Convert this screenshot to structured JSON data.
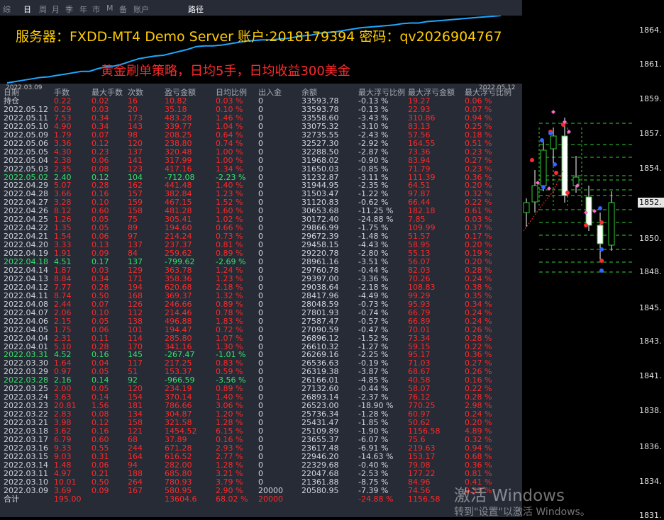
{
  "tabs": [
    "综",
    "日",
    "周",
    "月",
    "季",
    "年",
    "市",
    "M",
    "备",
    "账户",
    "路径"
  ],
  "banner": {
    "line1": "服务器：FXDD-MT4 Demo Server  账户:2018179394    密码：qv2026904767",
    "line2": "黄金刷单策略，日均5手，日均收益300美金",
    "date_start": "2022.03.09",
    "date_end": "2022.05.12",
    "equity_curve": [
      0,
      2,
      4,
      6,
      8,
      9,
      11,
      13,
      15,
      17,
      17,
      21,
      24,
      25,
      28,
      32,
      36,
      38,
      40,
      41,
      44,
      47,
      50,
      54,
      55,
      55,
      56,
      58,
      60,
      62,
      63,
      64,
      64,
      65,
      66,
      68,
      70,
      71,
      74,
      75,
      76,
      78,
      80,
      82,
      83,
      84,
      85,
      86,
      88,
      89,
      89,
      91,
      92,
      93,
      94,
      95,
      96,
      97,
      98,
      99,
      100
    ]
  },
  "table": {
    "headers": [
      "日期",
      "手数",
      "最大手数",
      "次数",
      "盈亏金额",
      "日均比例",
      "出入金",
      "余额",
      "最大浮亏比例",
      "最大浮亏金额",
      "最大浮亏比例"
    ],
    "rows": [
      [
        "持仓",
        "0.22",
        "0.02",
        "16",
        "10.82",
        "0.03 %",
        "0",
        "33593.78",
        "-0.13 %",
        "19.27",
        "0.06 %"
      ],
      [
        "2022.05.12",
        "0.29",
        "0.03",
        "20",
        "35.18",
        "0.10 %",
        "0",
        "33593.78",
        "-0.13 %",
        "22.93",
        "0.07 %"
      ],
      [
        "2022.05.11",
        "7.53",
        "0.34",
        "173",
        "483.28",
        "1.46 %",
        "0",
        "33558.60",
        "-3.43 %",
        "310.86",
        "0.94 %"
      ],
      [
        "2022.05.10",
        "4.90",
        "0.34",
        "143",
        "339.77",
        "1.04 %",
        "0",
        "33075.32",
        "-3.10 %",
        "83.13",
        "0.25 %"
      ],
      [
        "2022.05.09",
        "1.79",
        "0.07",
        "98",
        "208.25",
        "0.64 %",
        "0",
        "32735.55",
        "-2.43 %",
        "57.56",
        "0.18 %"
      ],
      [
        "2022.05.06",
        "3.36",
        "0.12",
        "120",
        "238.80",
        "0.74 %",
        "0",
        "32527.30",
        "-2.92 %",
        "164.55",
        "0.51 %"
      ],
      [
        "2022.05.05",
        "4.30",
        "0.23",
        "137",
        "320.48",
        "1.00 %",
        "0",
        "32288.50",
        "-2.87 %",
        "73.36",
        "0.23 %"
      ],
      [
        "2022.05.04",
        "2.38",
        "0.06",
        "141",
        "317.99",
        "1.00 %",
        "0",
        "31968.02",
        "-0.90 %",
        "83.94",
        "0.27 %"
      ],
      [
        "2022.05.03",
        "2.35",
        "0.08",
        "123",
        "417.16",
        "1.34 %",
        "0",
        "31650.03",
        "-0.85 %",
        "71.79",
        "0.23 %"
      ],
      [
        "2022.05.02",
        "2.40",
        "0.12",
        "104",
        "-712.08",
        "-2.23 %",
        "0",
        "31232.87",
        "-3.11 %",
        "111.39",
        "0.36 %"
      ],
      [
        "2022.04.29",
        "5.07",
        "0.28",
        "162",
        "441.48",
        "1.40 %",
        "0",
        "31944.95",
        "-2.35 %",
        "64.51",
        "0.20 %"
      ],
      [
        "2022.04.28",
        "3.66",
        "0.16",
        "157",
        "382.84",
        "1.23 %",
        "0",
        "31503.47",
        "-1.22 %",
        "97.87",
        "0.32 %"
      ],
      [
        "2022.04.27",
        "3.28",
        "0.10",
        "159",
        "467.15",
        "1.52 %",
        "0",
        "31120.83",
        "-0.62 %",
        "66.44",
        "0.22 %"
      ],
      [
        "2022.04.26",
        "8.12",
        "0.60",
        "158",
        "481.28",
        "1.60 %",
        "0",
        "30653.68",
        "-11.25 %",
        "182.18",
        "0.61 %"
      ],
      [
        "2022.04.25",
        "1.26",
        "0.05",
        "75",
        "305.41",
        "1.02 %",
        "0",
        "30172.40",
        "-24.88 %",
        "7.85",
        "0.03 %"
      ],
      [
        "2022.04.22",
        "1.35",
        "0.05",
        "89",
        "194.60",
        "0.66 %",
        "0",
        "29866.99",
        "-1.75 %",
        "109.99",
        "0.37 %"
      ],
      [
        "2022.04.21",
        "1.54",
        "0.06",
        "97",
        "214.24",
        "0.73 %",
        "0",
        "29672.39",
        "-1.48 %",
        "51.57",
        "0.17 %"
      ],
      [
        "2022.04.20",
        "3.33",
        "0.13",
        "137",
        "237.37",
        "0.81 %",
        "0",
        "29458.15",
        "-4.43 %",
        "58.95",
        "0.20 %"
      ],
      [
        "2022.04.19",
        "1.91",
        "0.09",
        "84",
        "259.62",
        "0.89 %",
        "0",
        "29220.78",
        "-2.80 %",
        "55.13",
        "0.19 %"
      ],
      [
        "2022.04.18",
        "4.51",
        "0.17",
        "137",
        "-799.62",
        "-2.69 %",
        "0",
        "28961.16",
        "-3.51 %",
        "56.07",
        "0.20 %"
      ],
      [
        "2022.04.14",
        "1.87",
        "0.03",
        "129",
        "363.78",
        "1.24 %",
        "0",
        "29760.78",
        "-0.44 %",
        "82.03",
        "0.28 %"
      ],
      [
        "2022.04.13",
        "8.84",
        "0.34",
        "171",
        "358.36",
        "1.23 %",
        "0",
        "29397.00",
        "-3.36 %",
        "70.26",
        "0.24 %"
      ],
      [
        "2022.04.12",
        "7.77",
        "0.28",
        "194",
        "620.68",
        "2.18 %",
        "0",
        "29038.64",
        "-2.18 %",
        "108.83",
        "0.38 %"
      ],
      [
        "2022.04.11",
        "8.74",
        "0.50",
        "168",
        "369.37",
        "1.32 %",
        "0",
        "28417.96",
        "-4.49 %",
        "99.29",
        "0.35 %"
      ],
      [
        "2022.04.08",
        "2.44",
        "0.07",
        "126",
        "246.66",
        "0.89 %",
        "0",
        "28048.59",
        "-0.73 %",
        "95.93",
        "0.34 %"
      ],
      [
        "2022.04.07",
        "2.06",
        "0.10",
        "112",
        "214.46",
        "0.78 %",
        "0",
        "27801.93",
        "-0.74 %",
        "66.79",
        "0.24 %"
      ],
      [
        "2022.04.06",
        "2.15",
        "0.05",
        "138",
        "496.88",
        "1.83 %",
        "0",
        "27587.47",
        "-0.57 %",
        "66.89",
        "0.24 %"
      ],
      [
        "2022.04.05",
        "1.75",
        "0.06",
        "101",
        "194.47",
        "0.72 %",
        "0",
        "27090.59",
        "-0.47 %",
        "70.01",
        "0.26 %"
      ],
      [
        "2022.04.04",
        "2.31",
        "0.11",
        "114",
        "285.80",
        "1.07 %",
        "0",
        "26896.12",
        "-1.52 %",
        "73.34",
        "0.28 %"
      ],
      [
        "2022.04.01",
        "5.10",
        "0.28",
        "170",
        "341.16",
        "1.30 %",
        "0",
        "26610.32",
        "-1.27 %",
        "59.15",
        "0.22 %"
      ],
      [
        "2022.03.31",
        "4.52",
        "0.16",
        "145",
        "-267.47",
        "-1.01 %",
        "0",
        "26269.16",
        "-2.25 %",
        "95.17",
        "0.36 %"
      ],
      [
        "2022.03.30",
        "1.64",
        "0.04",
        "117",
        "217.25",
        "0.83 %",
        "0",
        "26536.63",
        "-0.19 %",
        "71.03",
        "0.27 %"
      ],
      [
        "2022.03.29",
        "0.97",
        "0.05",
        "51",
        "153.37",
        "0.59 %",
        "0",
        "26319.38",
        "-3.87 %",
        "68.67",
        "0.26 %"
      ],
      [
        "2022.03.28",
        "2.16",
        "0.14",
        "92",
        "-966.59",
        "-3.56 %",
        "0",
        "26166.01",
        "-4.85 %",
        "40.58",
        "0.16 %"
      ],
      [
        "2022.03.25",
        "2.00",
        "0.05",
        "120",
        "234.19",
        "0.89 %",
        "0",
        "27132.60",
        "-0.44 %",
        "58.07",
        "0.22 %"
      ],
      [
        "2022.03.24",
        "3.63",
        "0.14",
        "154",
        "370.14",
        "1.40 %",
        "0",
        "26893.14",
        "-2.37 %",
        "76.12",
        "0.28 %"
      ],
      [
        "2022.03.23",
        "20.81",
        "1.56",
        "181",
        "786.66",
        "3.06 %",
        "0",
        "26523.00",
        "-18.90 %",
        "770.25",
        "2.98 %"
      ],
      [
        "2022.03.22",
        "2.83",
        "0.08",
        "134",
        "304.87",
        "1.20 %",
        "0",
        "25736.34",
        "-1.28 %",
        "60.97",
        "0.24 %"
      ],
      [
        "2022.03.21",
        "3.98",
        "0.12",
        "158",
        "321.58",
        "1.28 %",
        "0",
        "25431.47",
        "-1.85 %",
        "50.62",
        "0.20 %"
      ],
      [
        "2022.03.18",
        "3.62",
        "0.16",
        "121",
        "1454.52",
        "6.15 %",
        "0",
        "25109.89",
        "-1.90 %",
        "1156.58",
        "4.89 %"
      ],
      [
        "2022.03.17",
        "6.79",
        "0.60",
        "68",
        "37.89",
        "0.16 %",
        "0",
        "23655.37",
        "-6.07 %",
        "75.6",
        "0.32 %"
      ],
      [
        "2022.03.16",
        "9.33",
        "0.55",
        "244",
        "671.28",
        "2.93 %",
        "0",
        "23617.48",
        "-6.91 %",
        "219.63",
        "0.94 %"
      ],
      [
        "2022.03.15",
        "9.03",
        "0.31",
        "164",
        "616.52",
        "2.77 %",
        "0",
        "22946.20",
        "-14.63 %",
        "153.17",
        "0.68 %"
      ],
      [
        "2022.03.14",
        "1.48",
        "0.06",
        "94",
        "282.00",
        "1.28 %",
        "0",
        "22329.68",
        "-0.40 %",
        "79.08",
        "0.36 %"
      ],
      [
        "2022.03.11",
        "4.97",
        "0.21",
        "188",
        "685.80",
        "3.21 %",
        "0",
        "22047.68",
        "-2.53 %",
        "177.22",
        "0.81 %"
      ],
      [
        "2022.03.10",
        "10.01",
        "0.50",
        "264",
        "780.93",
        "3.79 %",
        "0",
        "21361.88",
        "-8.75 %",
        "84.96",
        "0.41 %"
      ],
      [
        "2022.03.09",
        "3.69",
        "0.09",
        "167",
        "580.95",
        "2.90 %",
        "20000",
        "20580.95",
        "-7.39 %",
        "74.56",
        "0.37 %"
      ]
    ],
    "total": [
      "合计",
      "195.00",
      "",
      "",
      "13604.6",
      "68.02 %",
      "20000",
      "",
      "-24.88 %",
      "1156.58",
      ""
    ]
  },
  "price_axis": [
    "1864.",
    "1861.",
    "1859.",
    "1857.",
    "1854.",
    "1852.",
    "1850.",
    "1848.",
    "1845.",
    "1843.",
    "1841.",
    "1838.",
    "1836.",
    "1834.",
    "1831."
  ],
  "current_price": "1852.",
  "watermark": {
    "line1": "激活 Windows",
    "line2": "转到\"设置\"以激活 Windows。"
  },
  "colors": {
    "panel_bg": "#262b36",
    "profit": "#ff2a2a",
    "loss": "#37e26a",
    "title_yellow": "#ffcc00",
    "equity_line": "#1ea8ff"
  }
}
